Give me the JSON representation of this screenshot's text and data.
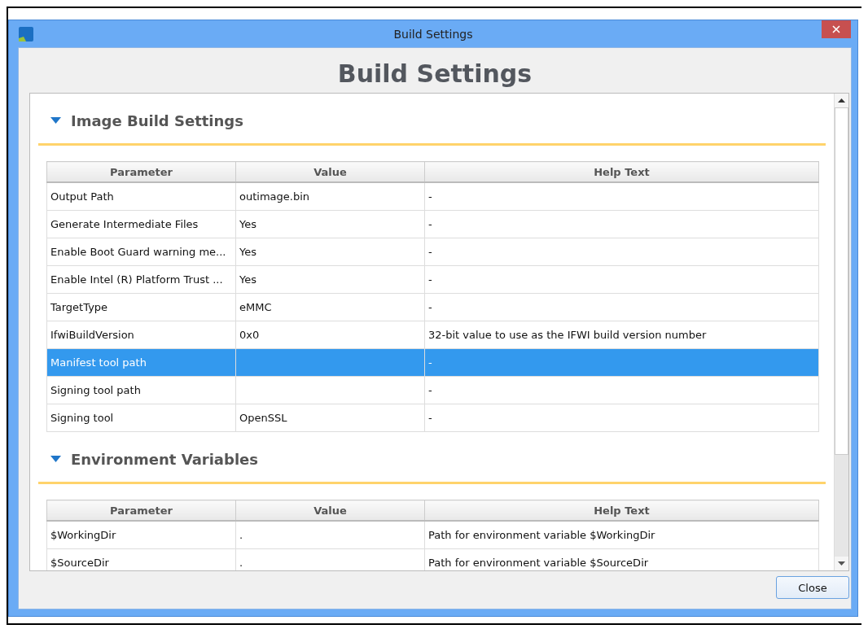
{
  "window": {
    "title": "Build Settings",
    "heading": "Build Settings"
  },
  "sections": [
    {
      "title": "Image Build Settings",
      "expanded": true,
      "columns": [
        "Parameter",
        "Value",
        "Help Text"
      ],
      "rows": [
        {
          "cells": [
            "Output Path",
            "outimage.bin",
            "-"
          ],
          "selected": false
        },
        {
          "cells": [
            "Generate Intermediate Files",
            "Yes",
            "-"
          ],
          "selected": false
        },
        {
          "cells": [
            "Enable Boot Guard warning me...",
            "Yes",
            "-"
          ],
          "selected": false
        },
        {
          "cells": [
            "Enable Intel (R) Platform Trust ...",
            "Yes",
            "-"
          ],
          "selected": false
        },
        {
          "cells": [
            "TargetType",
            "eMMC",
            "-"
          ],
          "selected": false
        },
        {
          "cells": [
            "IfwiBuildVersion",
            "0x0",
            "32-bit value to use as the IFWI build version number"
          ],
          "selected": false
        },
        {
          "cells": [
            "Manifest tool path",
            "",
            "-"
          ],
          "selected": true
        },
        {
          "cells": [
            "Signing tool path",
            "",
            "-"
          ],
          "selected": false
        },
        {
          "cells": [
            "Signing tool",
            "OpenSSL",
            "-"
          ],
          "selected": false
        }
      ]
    },
    {
      "title": "Environment Variables",
      "expanded": true,
      "columns": [
        "Parameter",
        "Value",
        "Help Text"
      ],
      "rows": [
        {
          "cells": [
            "$WorkingDir",
            ".",
            "Path for environment variable $WorkingDir"
          ],
          "selected": false
        },
        {
          "cells": [
            "$SourceDir",
            ".",
            "Path for environment variable $SourceDir"
          ],
          "selected": false
        }
      ]
    }
  ],
  "buttons": [
    "Close"
  ]
}
